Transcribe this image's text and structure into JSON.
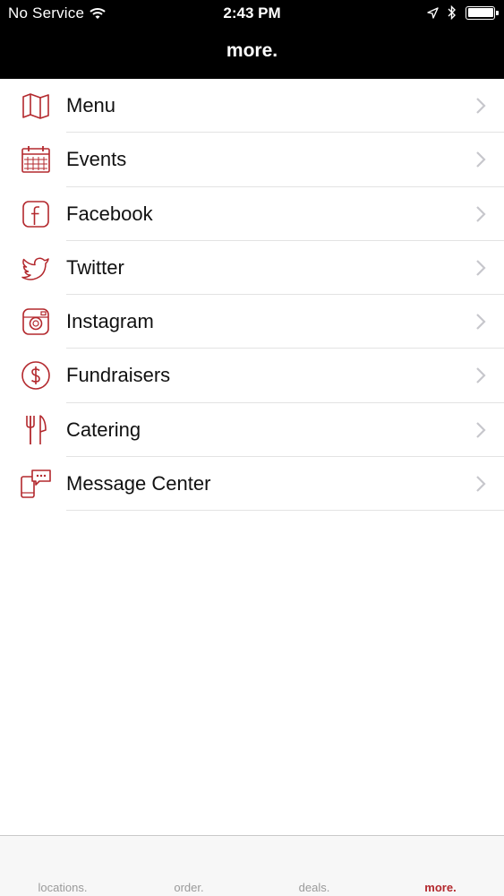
{
  "status_bar": {
    "carrier": "No Service",
    "time": "2:43 PM"
  },
  "nav": {
    "title": "more."
  },
  "accent_color": "#b3282d",
  "menu_items": [
    {
      "label": "Menu",
      "icon": "map-icon"
    },
    {
      "label": "Events",
      "icon": "calendar-icon"
    },
    {
      "label": "Facebook",
      "icon": "facebook-icon"
    },
    {
      "label": "Twitter",
      "icon": "twitter-icon"
    },
    {
      "label": "Instagram",
      "icon": "instagram-icon"
    },
    {
      "label": "Fundraisers",
      "icon": "dollar-circle-icon"
    },
    {
      "label": "Catering",
      "icon": "fork-knife-icon"
    },
    {
      "label": "Message Center",
      "icon": "message-center-icon"
    }
  ],
  "tabs": [
    {
      "label": "locations."
    },
    {
      "label": "order."
    },
    {
      "label": "deals."
    },
    {
      "label": "more.",
      "active": true
    }
  ]
}
